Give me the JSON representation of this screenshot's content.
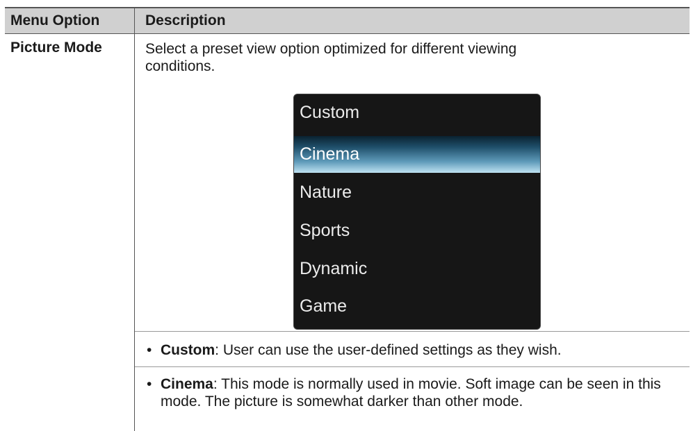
{
  "table": {
    "headers": {
      "col1": "Menu Option",
      "col2": "Description"
    }
  },
  "row": {
    "option_name": "Picture Mode",
    "intro": "Select a preset view option optimized for different viewing conditions.",
    "menu": {
      "items": [
        "Custom",
        "Cinema",
        "Nature",
        "Sports",
        "Dynamic",
        "Game"
      ],
      "selected": "Cinema"
    },
    "bullets": [
      {
        "term": "Custom",
        "text": ": User can use the user-defined settings as they wish."
      },
      {
        "term": "Cinema",
        "text": ": This mode is normally used in movie. Soft image can be seen in this mode. The picture is somewhat darker than other mode."
      }
    ]
  },
  "colors": {
    "header_bg": "#d0d0d0",
    "menu_bg": "#161616",
    "selected_highlight": "#5f9bba"
  }
}
